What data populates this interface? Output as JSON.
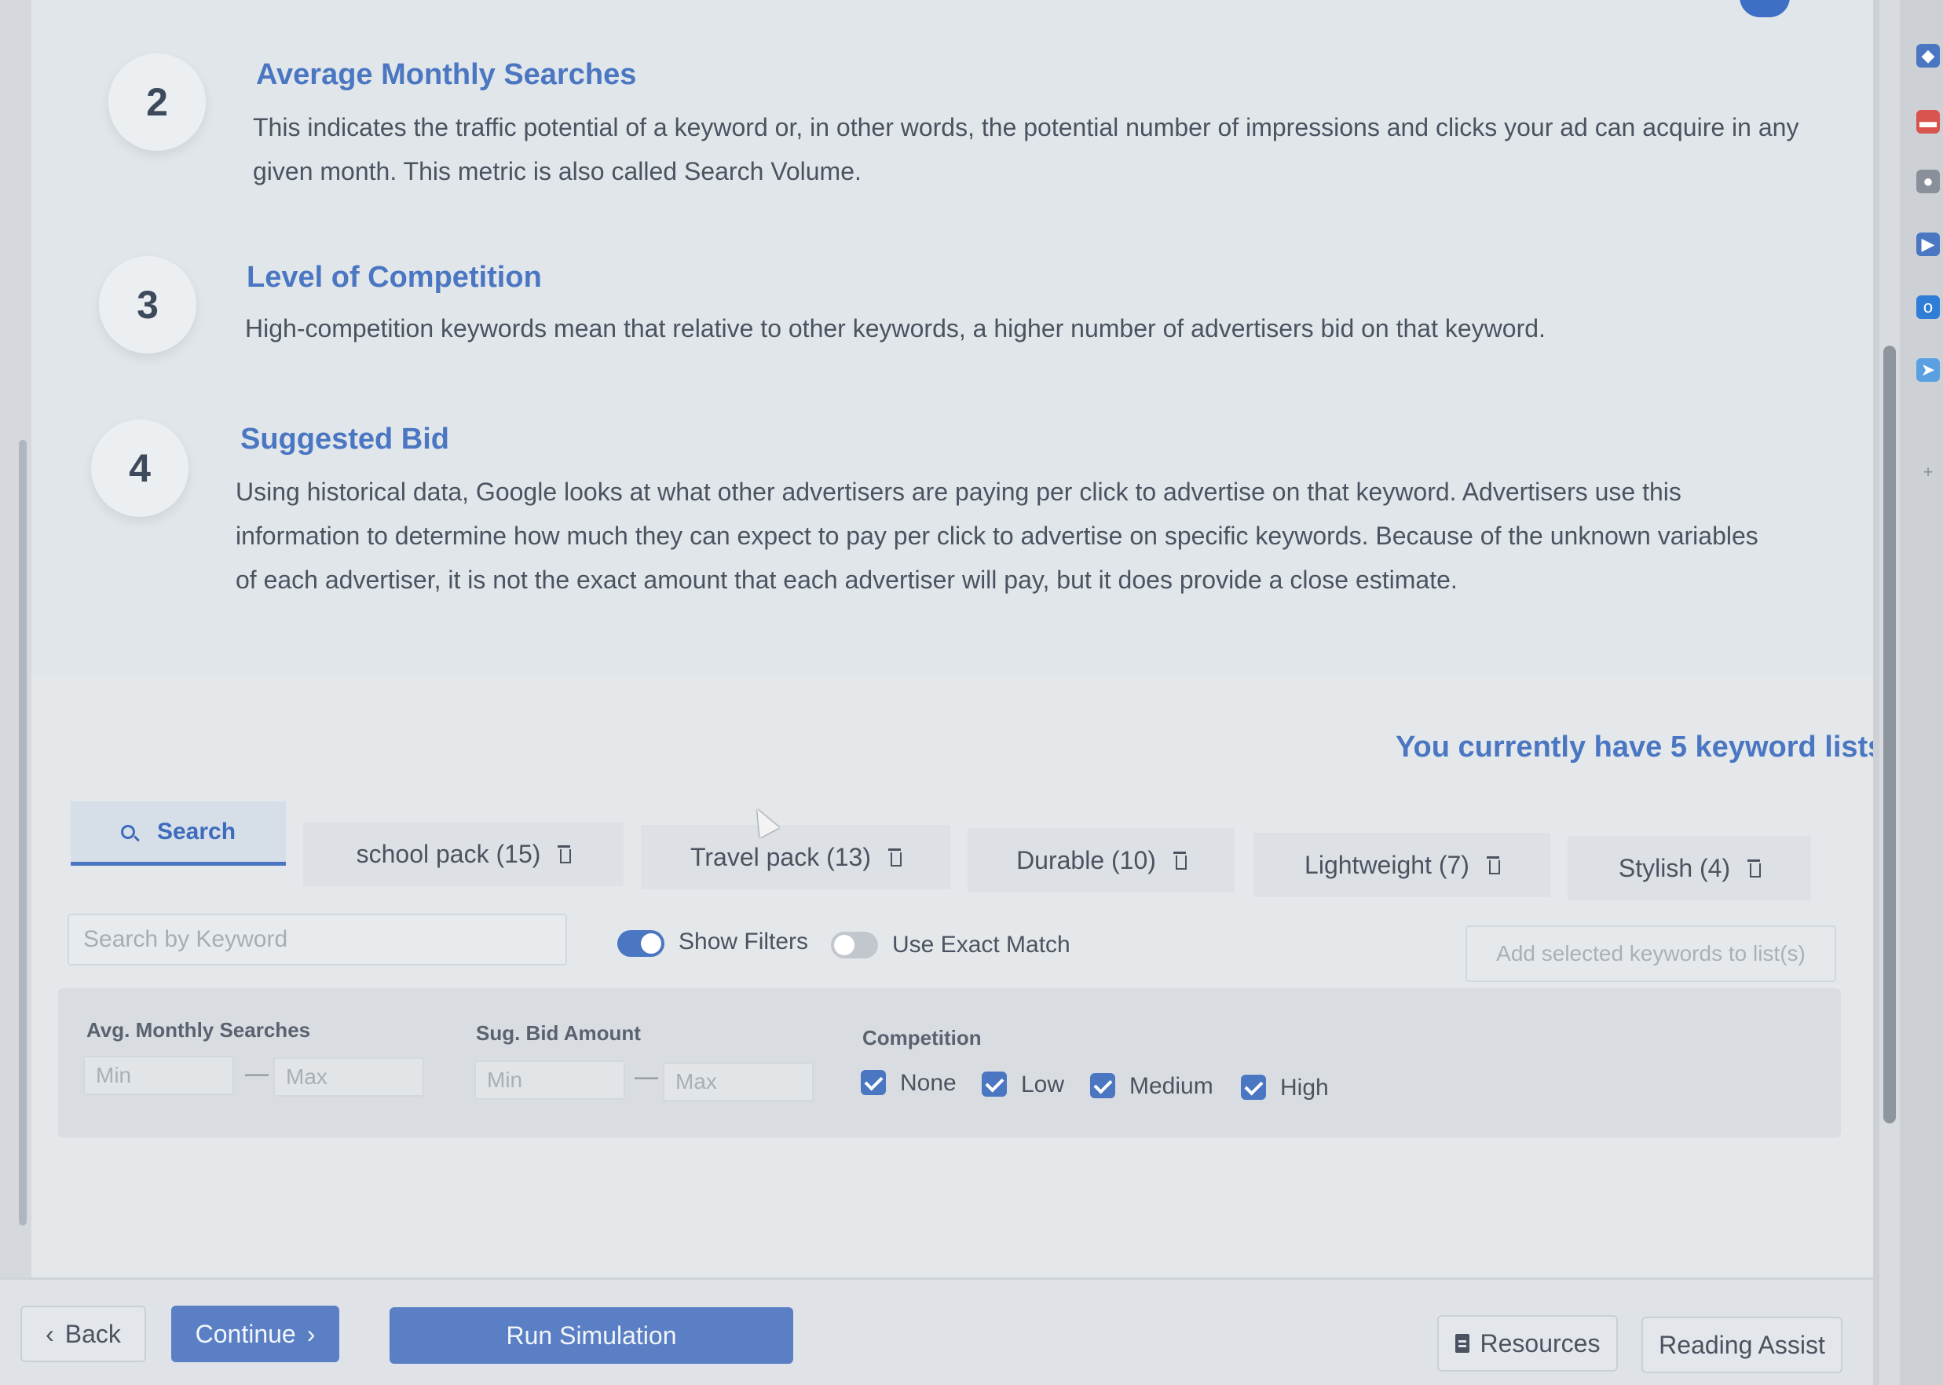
{
  "definitions": [
    {
      "number": "2",
      "title": "Average Monthly Searches",
      "body_lines": [
        "This indicates the traffic potential of a keyword or, in other words, the potential number of impressions and clicks your ad can acquire in any",
        "given month. This metric is also called Search Volume."
      ]
    },
    {
      "number": "3",
      "title": "Level of Competition",
      "body_lines": [
        "High-competition keywords mean that relative to other keywords, a higher number of advertisers bid on that keyword."
      ]
    },
    {
      "number": "4",
      "title": "Suggested Bid",
      "body_lines": [
        "Using historical data, Google looks at what other advertisers are paying per click to advertise on that keyword. Advertisers use this",
        "information to determine how much they can expect to pay per click to advertise on specific keywords. Because of the unknown variables",
        "of each advertiser, it is not the exact amount that each advertiser will pay, but it does provide a close estimate."
      ]
    }
  ],
  "keyword_lists_status": "You currently have 5 keyword lists",
  "tabs": [
    {
      "label": "Search",
      "icon": "search-icon",
      "active": true
    },
    {
      "label": "school pack (15)",
      "icon": "trash-icon"
    },
    {
      "label": "Travel pack (13)",
      "icon": "trash-icon"
    },
    {
      "label": "Durable (10)",
      "icon": "trash-icon"
    },
    {
      "label": "Lightweight (7)",
      "icon": "trash-icon"
    },
    {
      "label": "Stylish (4)",
      "icon": "trash-icon"
    }
  ],
  "controls": {
    "search_placeholder": "Search by Keyword",
    "show_filters_label": "Show Filters",
    "show_filters_on": true,
    "exact_match_label": "Use Exact Match",
    "exact_match_on": false,
    "add_button_label": "Add selected keywords to list(s)"
  },
  "filters": {
    "avg_searches_label": "Avg. Monthly Searches",
    "sug_bid_label": "Sug. Bid Amount",
    "competition_label": "Competition",
    "min_placeholder": "Min",
    "max_placeholder": "Max",
    "competition_options": [
      {
        "label": "None",
        "checked": true
      },
      {
        "label": "Low",
        "checked": true
      },
      {
        "label": "Medium",
        "checked": true
      },
      {
        "label": "High",
        "checked": true
      }
    ]
  },
  "footer": {
    "back_label": "Back",
    "continue_label": "Continue",
    "run_label": "Run Simulation",
    "resources_label": "Resources",
    "reading_assist_label": "Reading Assist"
  },
  "colors": {
    "accent": "#4a76c2",
    "primary_button": "#5a7fc4",
    "background": "#e1e6ea"
  }
}
